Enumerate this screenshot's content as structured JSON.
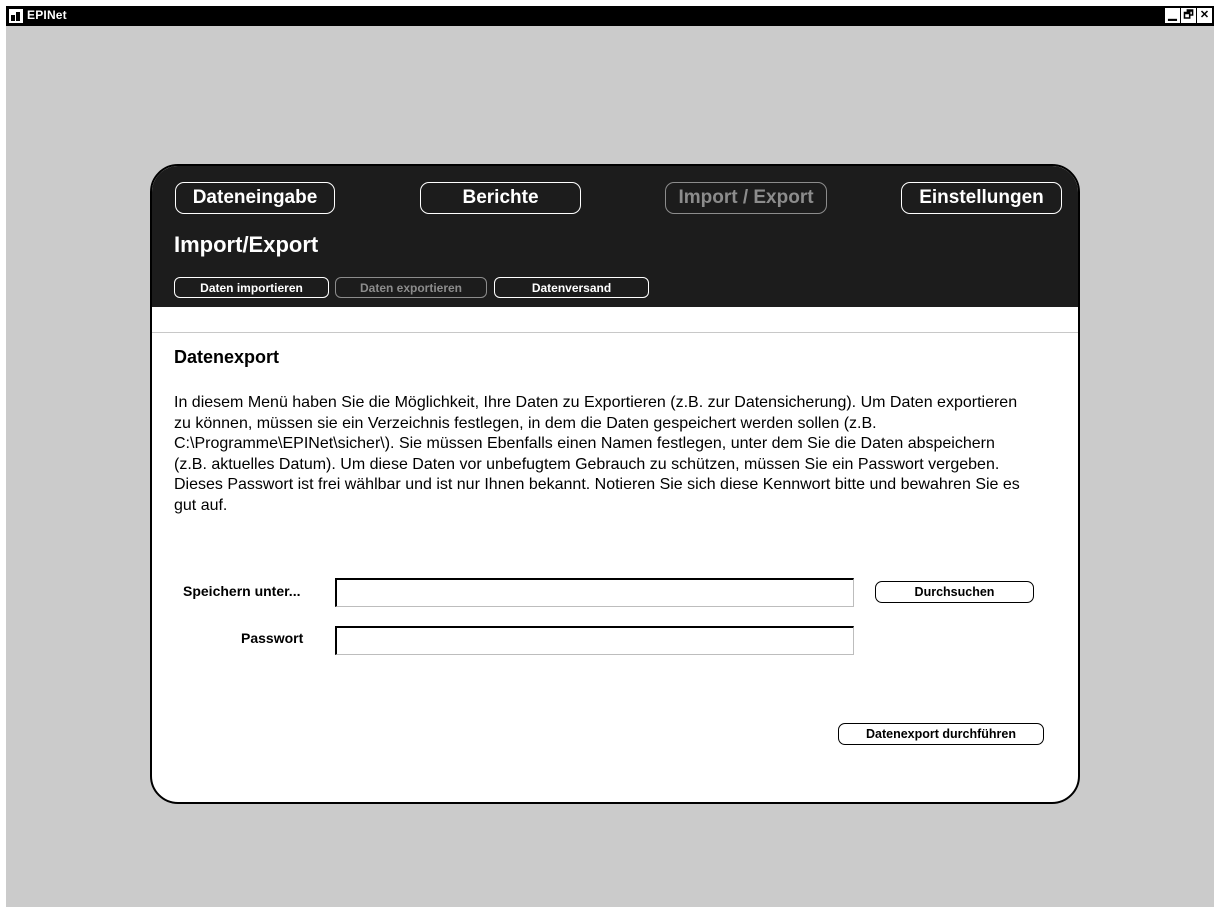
{
  "window": {
    "title": "EPINet",
    "controls": {
      "minimize": "▁",
      "maximize": "🗗",
      "close": "✕"
    }
  },
  "nav": {
    "items": [
      {
        "label": "Dateneingabe",
        "active": false
      },
      {
        "label": "Berichte",
        "active": false
      },
      {
        "label": "Import / Export",
        "active": true
      },
      {
        "label": "Einstellungen",
        "active": false
      }
    ]
  },
  "section": {
    "title": "Import/Export",
    "subnav": [
      {
        "label": "Daten importieren",
        "active": false
      },
      {
        "label": "Daten exportieren",
        "active": true
      },
      {
        "label": "Datenversand",
        "active": false
      }
    ]
  },
  "content": {
    "heading": "Datenexport",
    "description": "In diesem Menü haben Sie die Möglichkeit, Ihre Daten zu Exportieren (z.B. zur Datensicherung). Um Daten exportieren zu können, müssen sie ein Verzeichnis festlegen, in dem die Daten gespeichert werden sollen (z.B. C:\\Programme\\EPINet\\sicher\\). Sie müssen Ebenfalls einen Namen festlegen, unter dem Sie die Daten abspeichern (z.B. aktuelles Datum). Um diese Daten vor unbefugtem Gebrauch zu schützen, müssen Sie ein Passwort vergeben. Dieses Passwort ist frei wählbar und ist nur Ihnen bekannt. Notieren Sie sich diese Kennwort bitte und bewahren Sie es gut auf.",
    "form": {
      "save_as_label": "Speichern unter...",
      "save_as_value": "",
      "browse_label": "Durchsuchen",
      "password_label": "Passwort",
      "password_value": ""
    },
    "execute_label": "Datenexport durchführen"
  },
  "colors": {
    "header_bg": "#1c1c1c",
    "desktop_bg": "#cbcbcb",
    "disabled": "#8c8c8c"
  },
  "icons": {
    "app": "app-window-icon"
  }
}
